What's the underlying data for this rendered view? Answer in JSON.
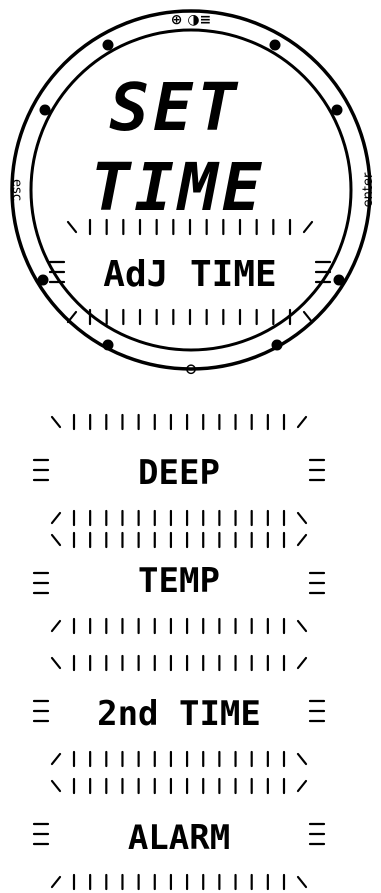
{
  "watch": {
    "top_button_label": "⊕ ◑≡",
    "bottom_button_label": "⊖",
    "left_button_label": "esc",
    "right_button_label": "enter",
    "title_line1": "SET",
    "title_line2": "TIME",
    "menu_item": "AdJ TIME"
  },
  "menu_items": [
    {
      "label": "DEEP"
    },
    {
      "label": "TEMP"
    },
    {
      "label": "2nd TIME"
    },
    {
      "label": "ALARM"
    }
  ]
}
